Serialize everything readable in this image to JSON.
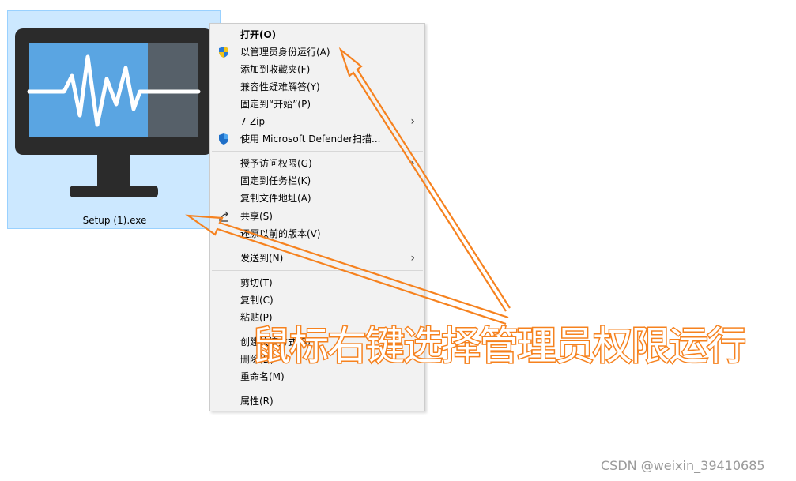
{
  "file": {
    "name": "Setup (1).exe",
    "icon": "monitor-waveform-icon"
  },
  "context_menu": {
    "items": [
      {
        "label": "打开(O)",
        "bold": true
      },
      {
        "label": "以管理员身份运行(A)",
        "icon": "uac-shield-icon"
      },
      {
        "label": "添加到收藏夹(F)"
      },
      {
        "label": "兼容性疑难解答(Y)"
      },
      {
        "label": "固定到“开始”(P)"
      },
      {
        "label": "7-Zip",
        "submenu": true
      },
      {
        "label": "使用 Microsoft Defender扫描...",
        "icon": "defender-shield-icon"
      },
      {
        "label": "授予访问权限(G)",
        "submenu": true
      },
      {
        "label": "固定到任务栏(K)"
      },
      {
        "label": "复制文件地址(A)"
      },
      {
        "label": "共享(S)",
        "icon": "share-icon"
      },
      {
        "label": "还原以前的版本(V)"
      },
      {
        "label": "发送到(N)",
        "submenu": true
      },
      {
        "label": "剪切(T)"
      },
      {
        "label": "复制(C)"
      },
      {
        "label": "粘贴(P)"
      },
      {
        "label": "创建快捷方式(S)"
      },
      {
        "label": "删除(D)"
      },
      {
        "label": "重命名(M)"
      },
      {
        "label": "属性(R)"
      }
    ],
    "submenu_arrow": "›"
  },
  "annotation": {
    "text": "鼠标右键选择管理员权限运行",
    "color": "#f6821f"
  },
  "watermark": "CSDN @weixin_39410685"
}
